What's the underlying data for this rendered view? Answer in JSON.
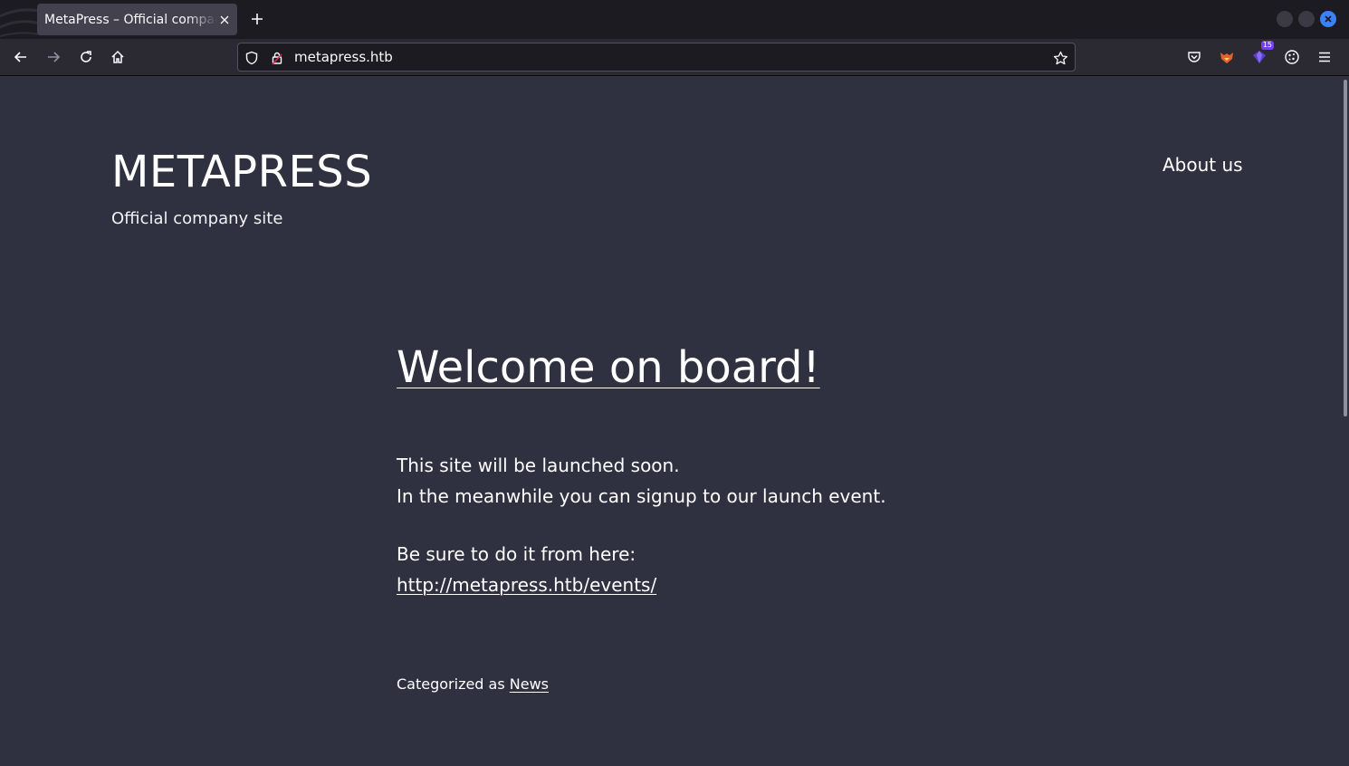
{
  "browser": {
    "tab": {
      "title": "MetaPress – Official company site"
    },
    "url": "metapress.htb",
    "extension_badge": "15",
    "icons": {
      "back": "back-arrow-icon",
      "forward": "forward-arrow-icon",
      "reload": "reload-icon",
      "home": "home-icon",
      "tracking": "shield-icon",
      "security": "lock-icon",
      "bookmark": "star-icon",
      "pocket": "pocket-icon",
      "foxyproxy": "fox-icon",
      "extension": "extension-icon",
      "cookie": "cookie-icon",
      "menu": "hamburger-menu-icon"
    }
  },
  "site": {
    "title": "METAPRESS",
    "description": "Official company site",
    "nav": {
      "about": "About us"
    }
  },
  "post": {
    "title": "Welcome on board!",
    "line1": "This site will be launched soon.",
    "line2": "In the meanwhile you can signup to our launch event.",
    "line3": "Be sure to do it from here:",
    "link": "http://metapress.htb/events/",
    "category_prefix": "Categorized as",
    "category": "News"
  },
  "colors": {
    "page_background": "#2f3040",
    "tab_bar": "#1c1b22",
    "nav_bar": "#2b2a33",
    "text": "#ffffff",
    "window_close": "#3b82f6"
  }
}
